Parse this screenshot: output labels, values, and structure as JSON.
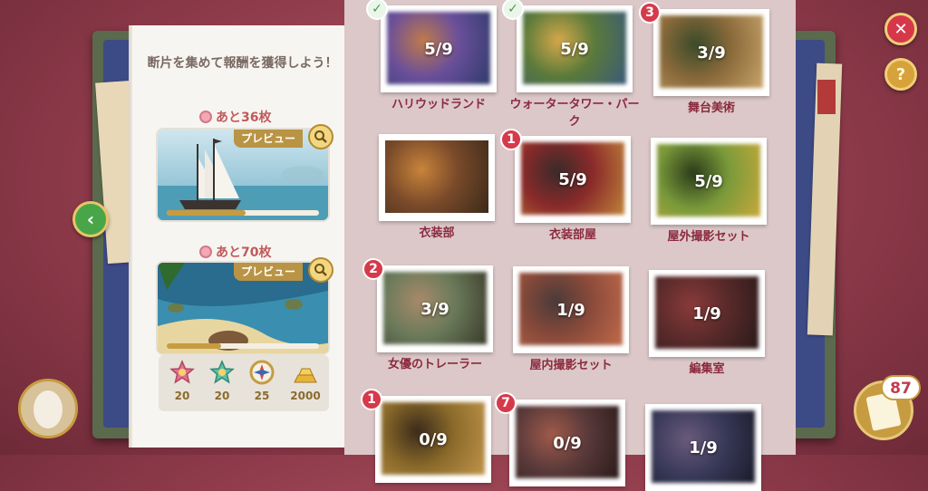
{
  "left_panel": {
    "intro": "断片を集めて報酬を獲得しよう！",
    "rewards": [
      {
        "remaining": "あと36枚",
        "preview_label": "プレビュー",
        "progress": 0.52
      },
      {
        "remaining": "あと70枚",
        "preview_label": "プレビュー",
        "progress": 0.36
      }
    ],
    "items": [
      {
        "icon": "star-medal-pink-icon",
        "qty": "20"
      },
      {
        "icon": "star-medal-teal-icon",
        "qty": "20"
      },
      {
        "icon": "compass-icon",
        "qty": "25"
      },
      {
        "icon": "gold-bars-icon",
        "qty": "2000"
      }
    ]
  },
  "locations": [
    {
      "name": "ハリウッドランド",
      "progress": "5/9",
      "badge": "check"
    },
    {
      "name": "ウォータータワー・パーク",
      "progress": "5/9",
      "badge": "check"
    },
    {
      "name": "舞台美術",
      "progress": "3/9",
      "badge": "3"
    },
    {
      "name": "衣装部",
      "progress": "",
      "badge": ""
    },
    {
      "name": "衣装部屋",
      "progress": "5/9",
      "badge": "1"
    },
    {
      "name": "屋外撮影セット",
      "progress": "5/9",
      "badge": ""
    },
    {
      "name": "女優のトレーラー",
      "progress": "3/9",
      "badge": "2"
    },
    {
      "name": "屋内撮影セット",
      "progress": "1/9",
      "badge": ""
    },
    {
      "name": "編集室",
      "progress": "1/9",
      "badge": ""
    },
    {
      "name": "",
      "progress": "0/9",
      "badge": "1"
    },
    {
      "name": "",
      "progress": "0/9",
      "badge": "7"
    },
    {
      "name": "",
      "progress": "1/9",
      "badge": ""
    }
  ],
  "hud": {
    "close_icon": "close-icon",
    "help_label": "?",
    "back_icon": "chevron-left-icon",
    "fragment_count": "87"
  }
}
